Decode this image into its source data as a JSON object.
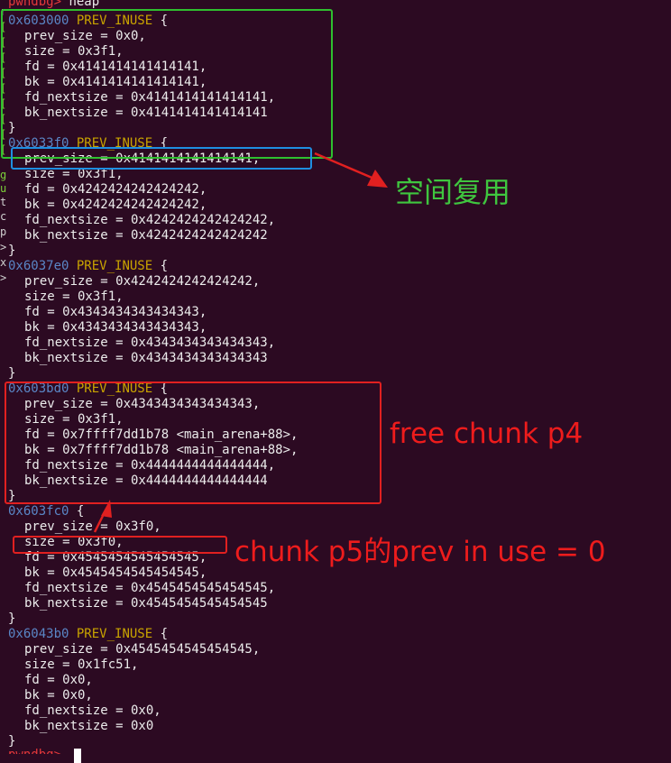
{
  "prompt": {
    "name": "pwndbg>",
    "command": "heap"
  },
  "chunks": [
    {
      "addr": "0x603000",
      "flag": "PREV_INUSE",
      "open": " {",
      "fields": [
        "prev_size = 0x0,",
        "size = 0x3f1,",
        "fd = 0x4141414141414141,",
        "bk = 0x4141414141414141,",
        "fd_nextsize = 0x4141414141414141,",
        "bk_nextsize = 0x4141414141414141"
      ]
    },
    {
      "addr": "0x6033f0",
      "flag": "PREV_INUSE",
      "open": " {",
      "fields": [
        "prev_size = 0x4141414141414141,",
        "size = 0x3f1,",
        "fd = 0x4242424242424242,",
        "bk = 0x4242424242424242,",
        "fd_nextsize = 0x4242424242424242,",
        "bk_nextsize = 0x4242424242424242"
      ]
    },
    {
      "addr": "0x6037e0",
      "flag": "PREV_INUSE",
      "open": " {",
      "fields": [
        "prev_size = 0x4242424242424242,",
        "size = 0x3f1,",
        "fd = 0x4343434343434343,",
        "bk = 0x4343434343434343,",
        "fd_nextsize = 0x4343434343434343,",
        "bk_nextsize = 0x4343434343434343"
      ]
    },
    {
      "addr": "0x603bd0",
      "flag": "PREV_INUSE",
      "open": " {",
      "fields": [
        "prev_size = 0x4343434343434343,",
        "size = 0x3f1,",
        "fd = 0x7ffff7dd1b78 <main_arena+88>,",
        "bk = 0x7ffff7dd1b78 <main_arena+88>,",
        "fd_nextsize = 0x4444444444444444,",
        "bk_nextsize = 0x4444444444444444"
      ]
    },
    {
      "addr": "0x603fc0",
      "flag": "",
      "open": " {",
      "fields": [
        "prev_size = 0x3f0,",
        "size = 0x3f0,",
        "fd = 0x4545454545454545,",
        "bk = 0x4545454545454545,",
        "fd_nextsize = 0x4545454545454545,",
        "bk_nextsize = 0x4545454545454545"
      ]
    },
    {
      "addr": "0x6043b0",
      "flag": "PREV_INUSE",
      "open": " {",
      "fields": [
        "prev_size = 0x4545454545454545,",
        "size = 0x1fc51,",
        "fd = 0x0,",
        "bk = 0x0,",
        "fd_nextsize = 0x0,",
        "bk_nextsize = 0x0"
      ]
    }
  ],
  "close_brace": "}",
  "gutter": [
    "r",
    "[",
    "[",
    "[",
    "[",
    "[",
    "[",
    "[",
    "[",
    "[",
    "g",
    "u",
    "t",
    "c",
    "p",
    ">",
    "x",
    ">"
  ],
  "annotations": {
    "space_reuse": "空间复用",
    "free_chunk": "free chunk p4",
    "prev_in_use": "chunk p5的prev in use = 0"
  },
  "colors": {
    "background": "#2c0a22",
    "address": "#5a86c6",
    "flag": "#c9a400",
    "prompt": "#e5383b",
    "box_green": "#2fbf2f",
    "box_blue": "#1e8fe1",
    "box_red": "#e12020",
    "note_green": "#3fc63f",
    "note_red": "#ee1c1c"
  }
}
